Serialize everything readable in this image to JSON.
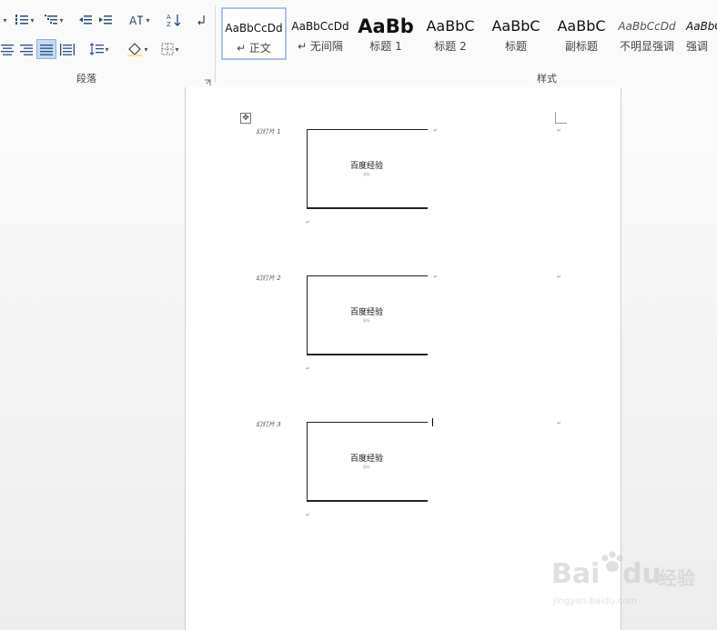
{
  "ribbon": {
    "paragraph_group_label": "段落",
    "styles_group_label": "样式",
    "styles": [
      {
        "sample": "AaBbCcDd",
        "name": "↵ 正文"
      },
      {
        "sample": "AaBbCcDd",
        "name": "↵ 无间隔"
      },
      {
        "sample": "AaBb",
        "name": "标题 1"
      },
      {
        "sample": "AaBbC",
        "name": "标题 2"
      },
      {
        "sample": "AaBbC",
        "name": "标题"
      },
      {
        "sample": "AaBbC",
        "name": "副标题"
      },
      {
        "sample": "AaBbCcDd",
        "name": "不明显强调"
      },
      {
        "sample": "AaBbC",
        "name": "强调"
      }
    ]
  },
  "document": {
    "slides": [
      {
        "label": "幻灯片 1",
        "title": "百度经验",
        "subtitle": "副标"
      },
      {
        "label": "幻灯片 2",
        "title": "百度经验",
        "subtitle": "副标"
      },
      {
        "label": "幻灯片 3",
        "title": "百度经验",
        "subtitle": "副标"
      }
    ],
    "return_mark": "↵"
  },
  "watermark": {
    "brand": "Bai",
    "brand_b": "du",
    "cn": "经验",
    "url": "jingyan.baidu.com"
  }
}
